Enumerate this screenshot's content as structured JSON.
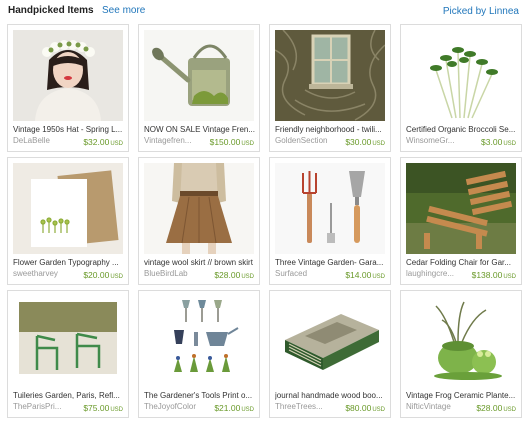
{
  "header": {
    "title": "Handpicked Items",
    "see_more": "See more",
    "picked_by": "Picked by Linnea"
  },
  "items": [
    {
      "title": "Vintage 1950s Hat - Spring L...",
      "shop": "DeLaBelle",
      "price": "$32.00",
      "currency": "USD",
      "thumb": "flower-crown-photo"
    },
    {
      "title": "NOW ON SALE Vintage Fren...",
      "shop": "Vintagefren...",
      "price": "$150.00",
      "currency": "USD",
      "thumb": "watering-can-photo"
    },
    {
      "title": "Friendly neighborhood - twili...",
      "shop": "GoldenSection",
      "price": "$30.00",
      "currency": "USD",
      "thumb": "window-vines-photo"
    },
    {
      "title": "Certified Organic Broccoli Se...",
      "shop": "WinsomeGr...",
      "price": "$3.00",
      "currency": "USD",
      "thumb": "sprouts-photo"
    },
    {
      "title": "Flower Garden Typography ...",
      "shop": "sweetharvey",
      "price": "$20.00",
      "currency": "USD",
      "thumb": "card-envelope-photo"
    },
    {
      "title": "vintage wool skirt // brown skirt",
      "shop": "BlueBirdLab",
      "price": "$28.00",
      "currency": "USD",
      "thumb": "brown-skirt-photo"
    },
    {
      "title": "Three Vintage Garden- Gara...",
      "shop": "Surfaced",
      "price": "$14.00",
      "currency": "USD",
      "thumb": "garden-tools-photo"
    },
    {
      "title": "Cedar Folding Chair for Gar...",
      "shop": "laughingcre...",
      "price": "$138.00",
      "currency": "USD",
      "thumb": "cedar-chair-photo"
    },
    {
      "title": "Tuileries Garden, Paris, Refl...",
      "shop": "TheParisPri...",
      "price": "$75.00",
      "currency": "USD",
      "thumb": "green-chairs-photo"
    },
    {
      "title": "The Gardener's Tools Print o...",
      "shop": "TheJoyofColor",
      "price": "$21.00",
      "currency": "USD",
      "thumb": "tools-print-photo"
    },
    {
      "title": "journal handmade wood boo...",
      "shop": "ThreeTrees...",
      "price": "$80.00",
      "currency": "USD",
      "thumb": "wood-journal-photo"
    },
    {
      "title": "Vintage Frog Ceramic Plante...",
      "shop": "NifticVintage",
      "price": "$28.00",
      "currency": "USD",
      "thumb": "frog-planter-photo"
    }
  ],
  "colors": {
    "link": "#2277bb",
    "price": "#6a9a2a",
    "border": "#dcdcdc"
  }
}
